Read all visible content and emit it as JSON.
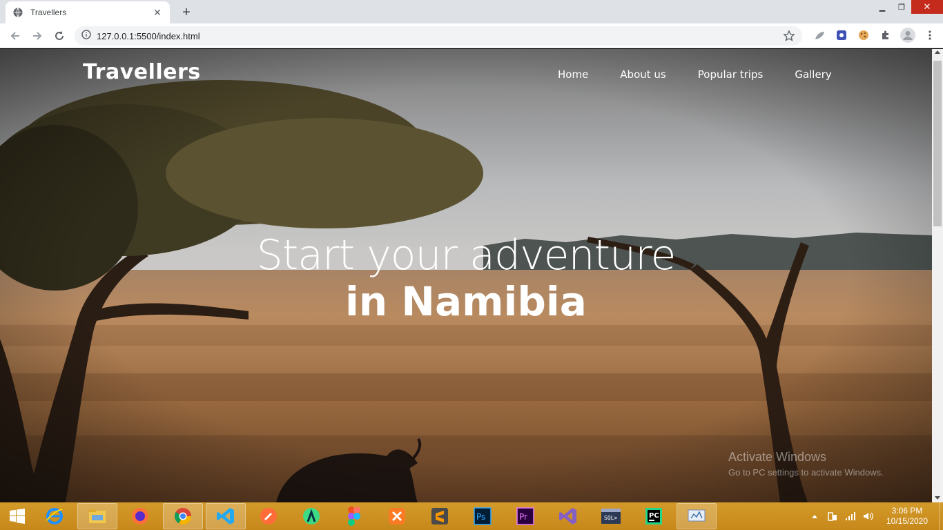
{
  "browser": {
    "tab_title": "Travellers",
    "url": "127.0.0.1:5500/index.html",
    "new_tab_label": "+"
  },
  "site": {
    "brand": "Travellers",
    "nav": [
      {
        "label": "Home"
      },
      {
        "label": "About us"
      },
      {
        "label": "Popular trips"
      },
      {
        "label": "Gallery"
      }
    ],
    "headline_line1": "Start your adventure",
    "headline_line2": "in Namibia"
  },
  "watermark": {
    "title": "Activate Windows",
    "subtitle": "Go to PC settings to activate Windows."
  },
  "taskbar": {
    "apps": [
      "internet-explorer",
      "file-explorer",
      "firefox",
      "chrome",
      "vs-code",
      "postman",
      "android-studio",
      "figma",
      "xampp",
      "sublime-text",
      "photoshop",
      "premiere-pro",
      "visual-studio",
      "sql-shell",
      "pycharm",
      "control-panel"
    ],
    "time": "3:06 PM",
    "date": "10/15/2020"
  },
  "colors": {
    "taskbar": "#c7881a",
    "close_button": "#c42b1c"
  }
}
